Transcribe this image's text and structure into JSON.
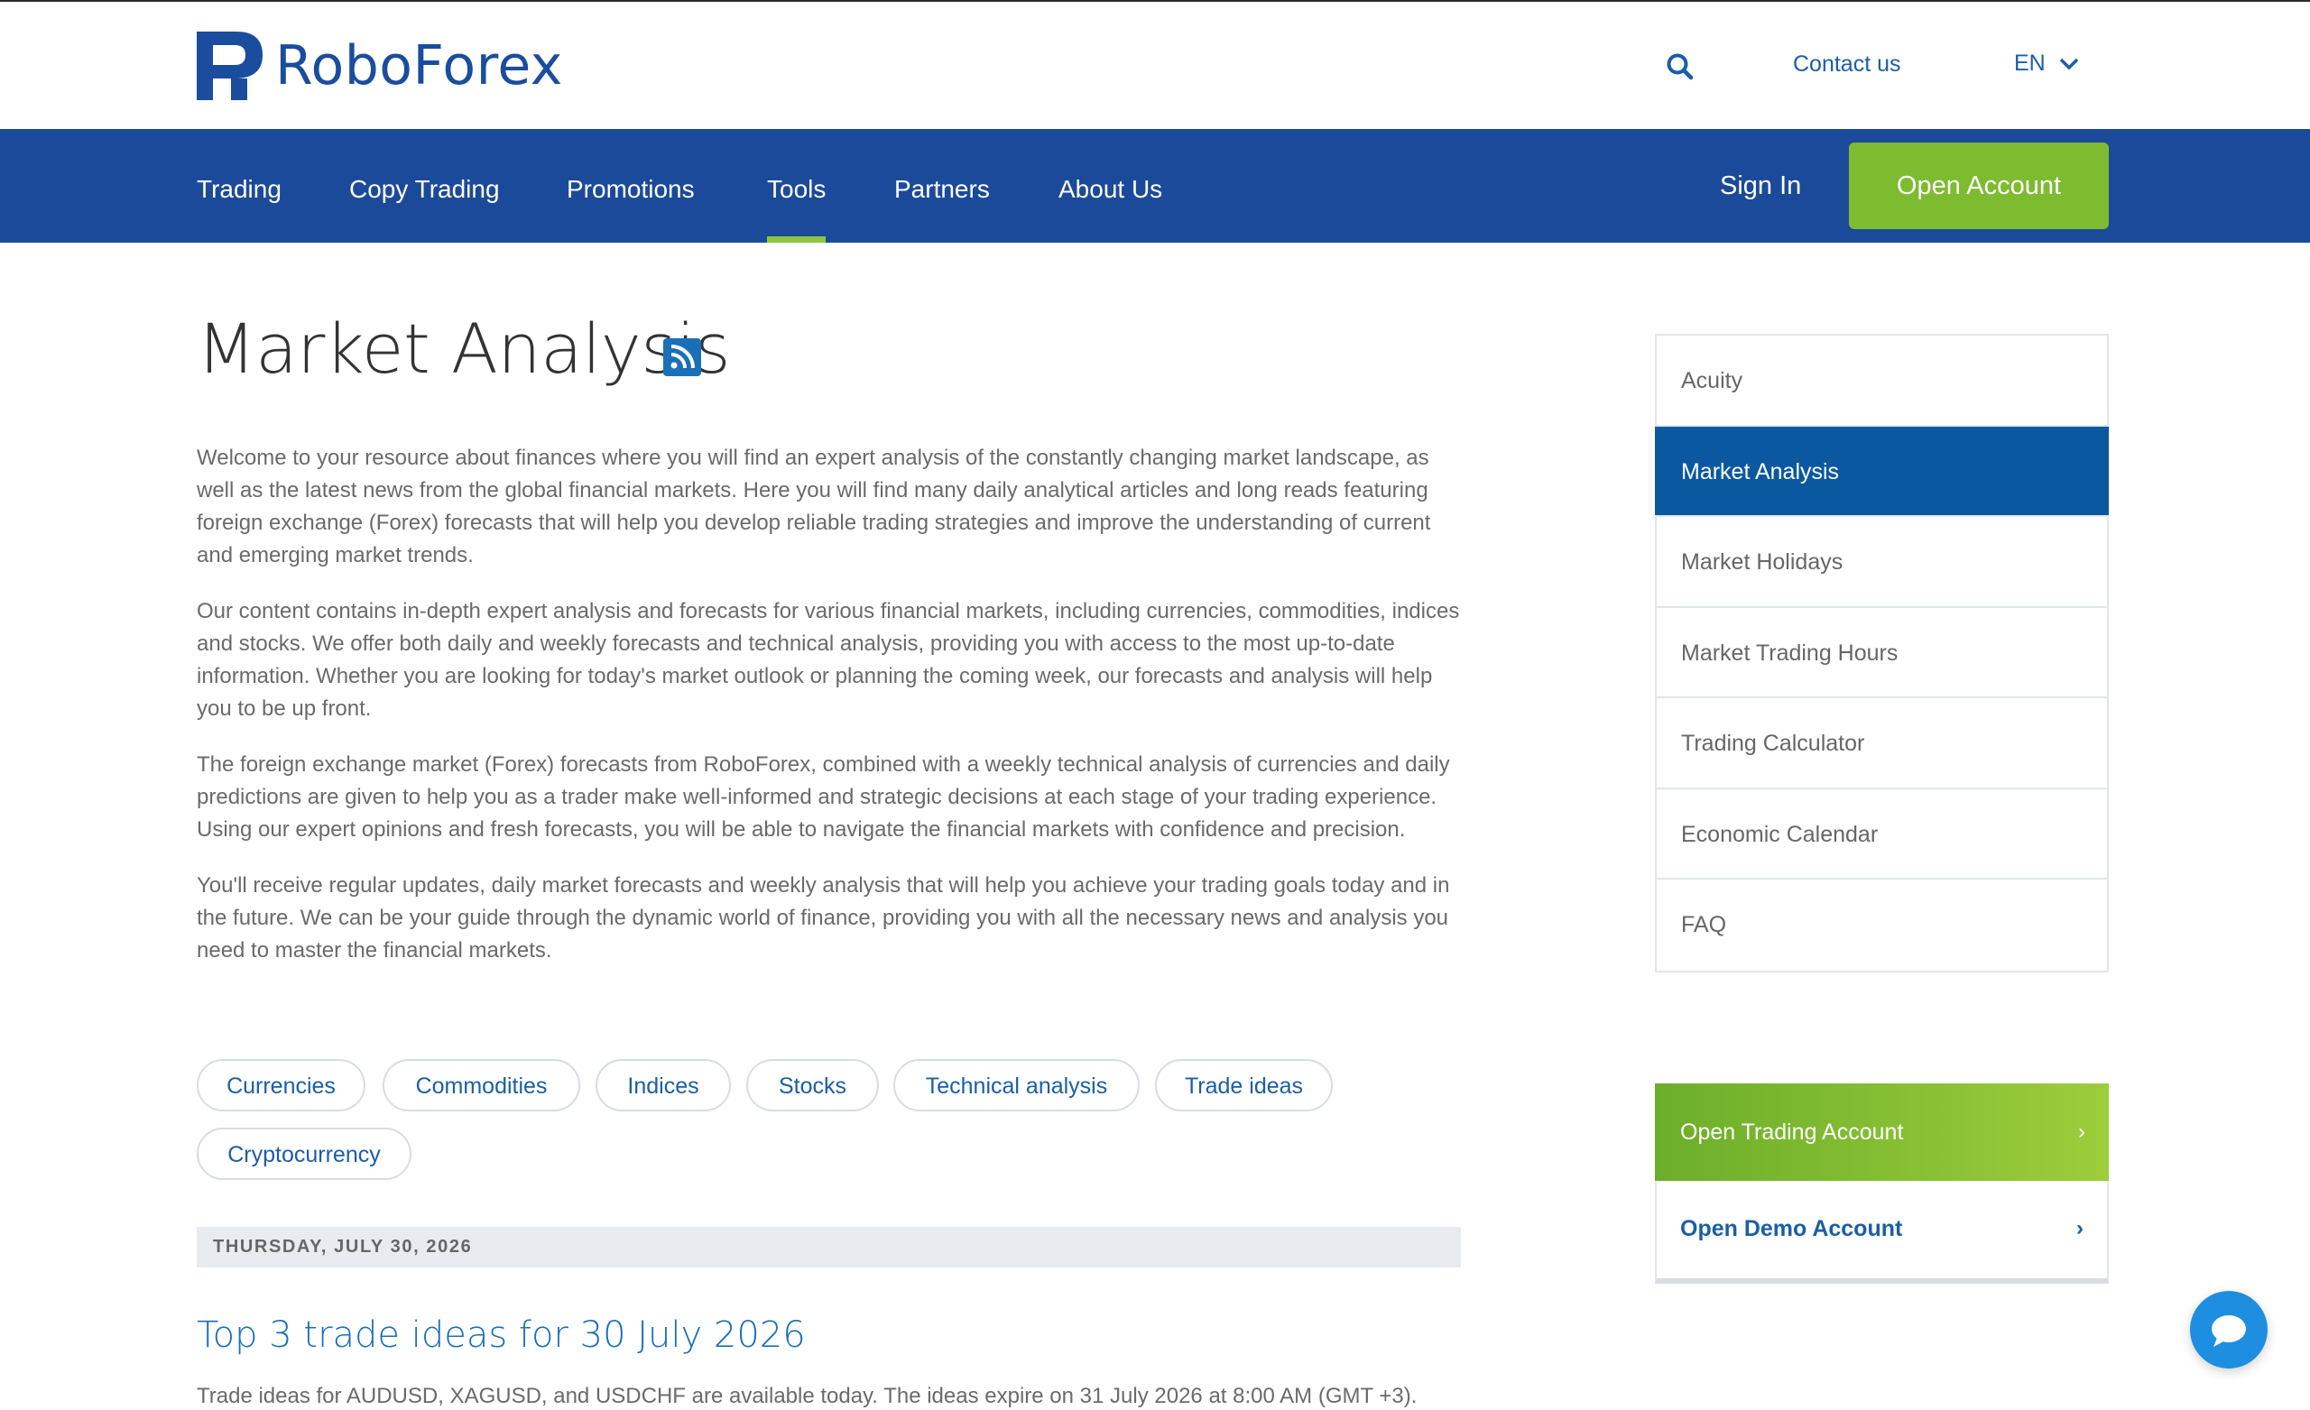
{
  "header": {
    "logo_text": "RoboForex",
    "contact_label": "Contact us",
    "language": "EN"
  },
  "nav": {
    "items": [
      {
        "label": "Trading"
      },
      {
        "label": "Copy Trading"
      },
      {
        "label": "Promotions"
      },
      {
        "label": "Tools",
        "active": true
      },
      {
        "label": "Partners"
      },
      {
        "label": "About Us"
      }
    ],
    "signin_label": "Sign In",
    "open_account_label": "Open Account"
  },
  "main": {
    "title": "Market Analysis",
    "paragraphs": [
      "Welcome to your resource about finances where you will find an expert analysis of the constantly changing market landscape, as well as the latest news from the global financial markets. Here you will find many daily analytical articles and long reads featuring foreign exchange (Forex) forecasts that will help you develop reliable trading strategies and improve the understanding of current and emerging market trends.",
      "Our content contains in-depth expert analysis and forecasts for various financial markets, including currencies, commodities, indices and stocks. We offer both daily and weekly forecasts and technical analysis, providing you with access to the most up-to-date information. Whether you are looking for today's market outlook or planning the coming week, our forecasts and analysis will help you to be up front.",
      "The foreign exchange market (Forex) forecasts from RoboForex, combined with a weekly technical analysis of currencies and daily predictions are given to help you as a trader make well-informed and strategic decisions at each stage of your trading experience. Using our expert opinions and fresh forecasts, you will be able to navigate the financial markets with confidence and precision.",
      "You'll receive regular updates, daily market forecasts and weekly analysis that will help you achieve your trading goals today and in the future. We can be your guide through the dynamic world of finance, providing you with all the necessary news and analysis you need to master the financial markets."
    ],
    "tags": [
      "Currencies",
      "Commodities",
      "Indices",
      "Stocks",
      "Technical analysis",
      "Trade ideas",
      "Cryptocurrency"
    ],
    "date_label": "THURSDAY, JULY 30, 2026",
    "post_title": "Top 3 trade ideas for 30 July 2026",
    "post_desc": "Trade ideas for AUDUSD, XAGUSD, and USDCHF are available today. The ideas expire on 31 July 2026 at 8:00 AM (GMT +3)."
  },
  "sidebar": {
    "items": [
      {
        "label": "Acuity"
      },
      {
        "label": "Market Analysis",
        "active": true
      },
      {
        "label": "Market Holidays"
      },
      {
        "label": "Market Trading Hours"
      },
      {
        "label": "Trading Calculator"
      },
      {
        "label": "Economic Calendar"
      },
      {
        "label": "FAQ"
      }
    ],
    "cta_trading": "Open Trading Account",
    "cta_demo": "Open Demo Account",
    "chevron": "›"
  },
  "colors": {
    "brand_blue": "#1b4a9a",
    "accent_green": "#7dbb2f",
    "active_blue": "#0a58a0",
    "link_blue": "#1a5ea8"
  },
  "icons": {
    "search": "search-icon",
    "language_dropdown": "chevron-down-icon",
    "rss": "rss-icon",
    "chat": "chat-icon"
  }
}
